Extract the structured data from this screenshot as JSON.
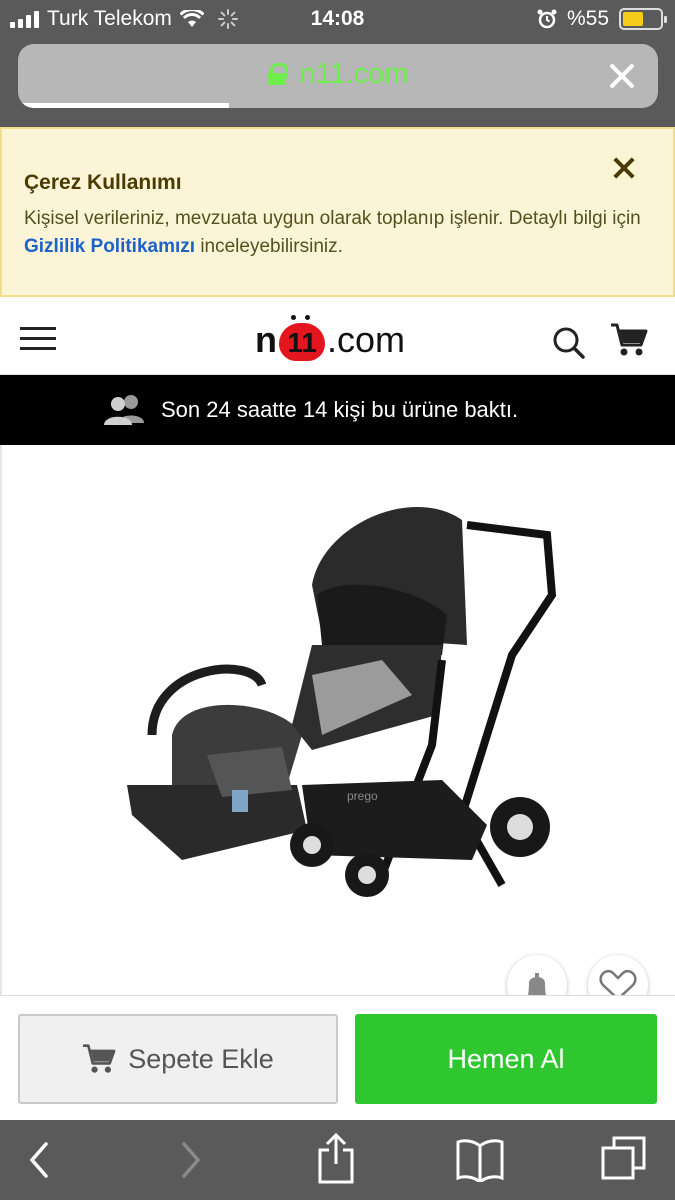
{
  "status_bar": {
    "carrier": "Turk Telekom",
    "time": "14:08",
    "battery": "%55",
    "battery_level": 0.55
  },
  "browser": {
    "url": "n11.com",
    "load_progress": 0.33
  },
  "cookie_banner": {
    "title": "Çerez Kullanımı",
    "text_before": "Kişisel verileriniz, mevzuata uygun olarak toplanıp işlenir. Detaylı bilgi için ",
    "link": "Gizlilik Politikamızı",
    "text_after": " inceleyebilirsiniz."
  },
  "header": {
    "logo_n": "n",
    "logo_11": "11",
    "logo_com": ".com"
  },
  "view_notice": {
    "text": "Son 24 saatte 14 kişi bu ürüne baktı."
  },
  "product": {
    "image_brand": "prego"
  },
  "actions": {
    "add_to_cart": "Sepete Ekle",
    "buy_now": "Hemen Al"
  },
  "colors": {
    "buy_green": "#2fc72f",
    "link_blue": "#1d62c9",
    "brand_red": "#e3151f",
    "url_green": "#6dee4d"
  }
}
